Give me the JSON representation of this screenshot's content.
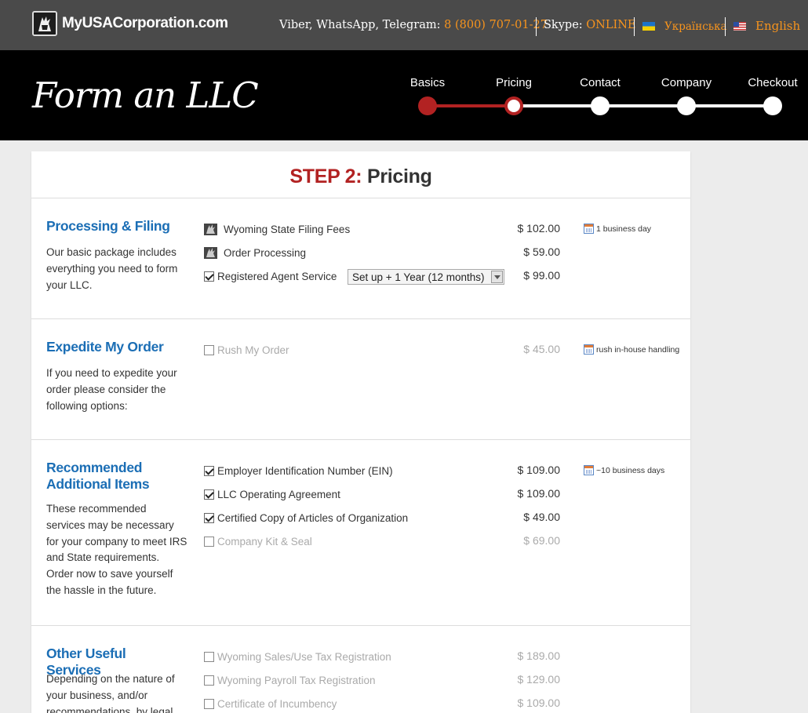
{
  "topbar": {
    "logo_text": "MyUSACorporation.com",
    "contact_label": "Viber, WhatsApp, Telegram:",
    "phone": "8 (800) 707-01-27",
    "skype_label": "Skype:",
    "skype_status": "ONLINE",
    "lang_ua": "Українська",
    "lang_en": "English"
  },
  "hero": {
    "title": "Form an LLC",
    "steps": [
      "Basics",
      "Pricing",
      "Contact",
      "Company",
      "Checkout"
    ],
    "current_step": "Pricing"
  },
  "page": {
    "step_prefix": "STEP 2:",
    "step_title": "Pricing"
  },
  "sections": [
    {
      "title": "Processing & Filing",
      "desc": "Our basic package includes everything you need to form your LLC.",
      "items": [
        {
          "label": "Wyoming State Filing Fees",
          "price": "$ 102.00",
          "note": "1 business day"
        },
        {
          "label": "Order Processing",
          "price": "$ 59.00"
        },
        {
          "label": "Registered Agent Service",
          "price": "$ 99.00",
          "select": "Set up + 1 Year (12 months)"
        }
      ]
    },
    {
      "title": "Expedite My Order",
      "desc": "If you need to expedite your order please consider the following options:",
      "items": [
        {
          "label": "Rush My Order",
          "price": "$ 45.00",
          "note": "rush in-house handling"
        }
      ]
    },
    {
      "title": "Recommended Additional Items",
      "desc": "These recommended services may be necessary for your company to meet IRS and State requirements. Order now to save yourself the hassle in the future.",
      "items": [
        {
          "label": "Employer Identification Number (EIN)",
          "price": "$ 109.00",
          "note": "~10 business days"
        },
        {
          "label": "LLC Operating Agreement",
          "price": "$ 109.00"
        },
        {
          "label": "Certified Copy of Articles of Organization",
          "price": "$ 49.00"
        },
        {
          "label": "Company Kit & Seal",
          "price": "$ 69.00"
        }
      ]
    },
    {
      "title": "Other Useful Services",
      "desc": "Depending on the nature of your business, and/or recommendations, by legal",
      "items": [
        {
          "label": "Wyoming Sales/Use Tax Registration",
          "price": "$ 189.00"
        },
        {
          "label": "Wyoming Payroll Tax Registration",
          "price": "$ 129.00"
        },
        {
          "label": "Certificate of Incumbency",
          "price": "$ 109.00"
        }
      ]
    }
  ],
  "colors": {
    "accent_red": "#b22222",
    "link_blue": "#1b6eb5",
    "orange": "#f7941d"
  }
}
